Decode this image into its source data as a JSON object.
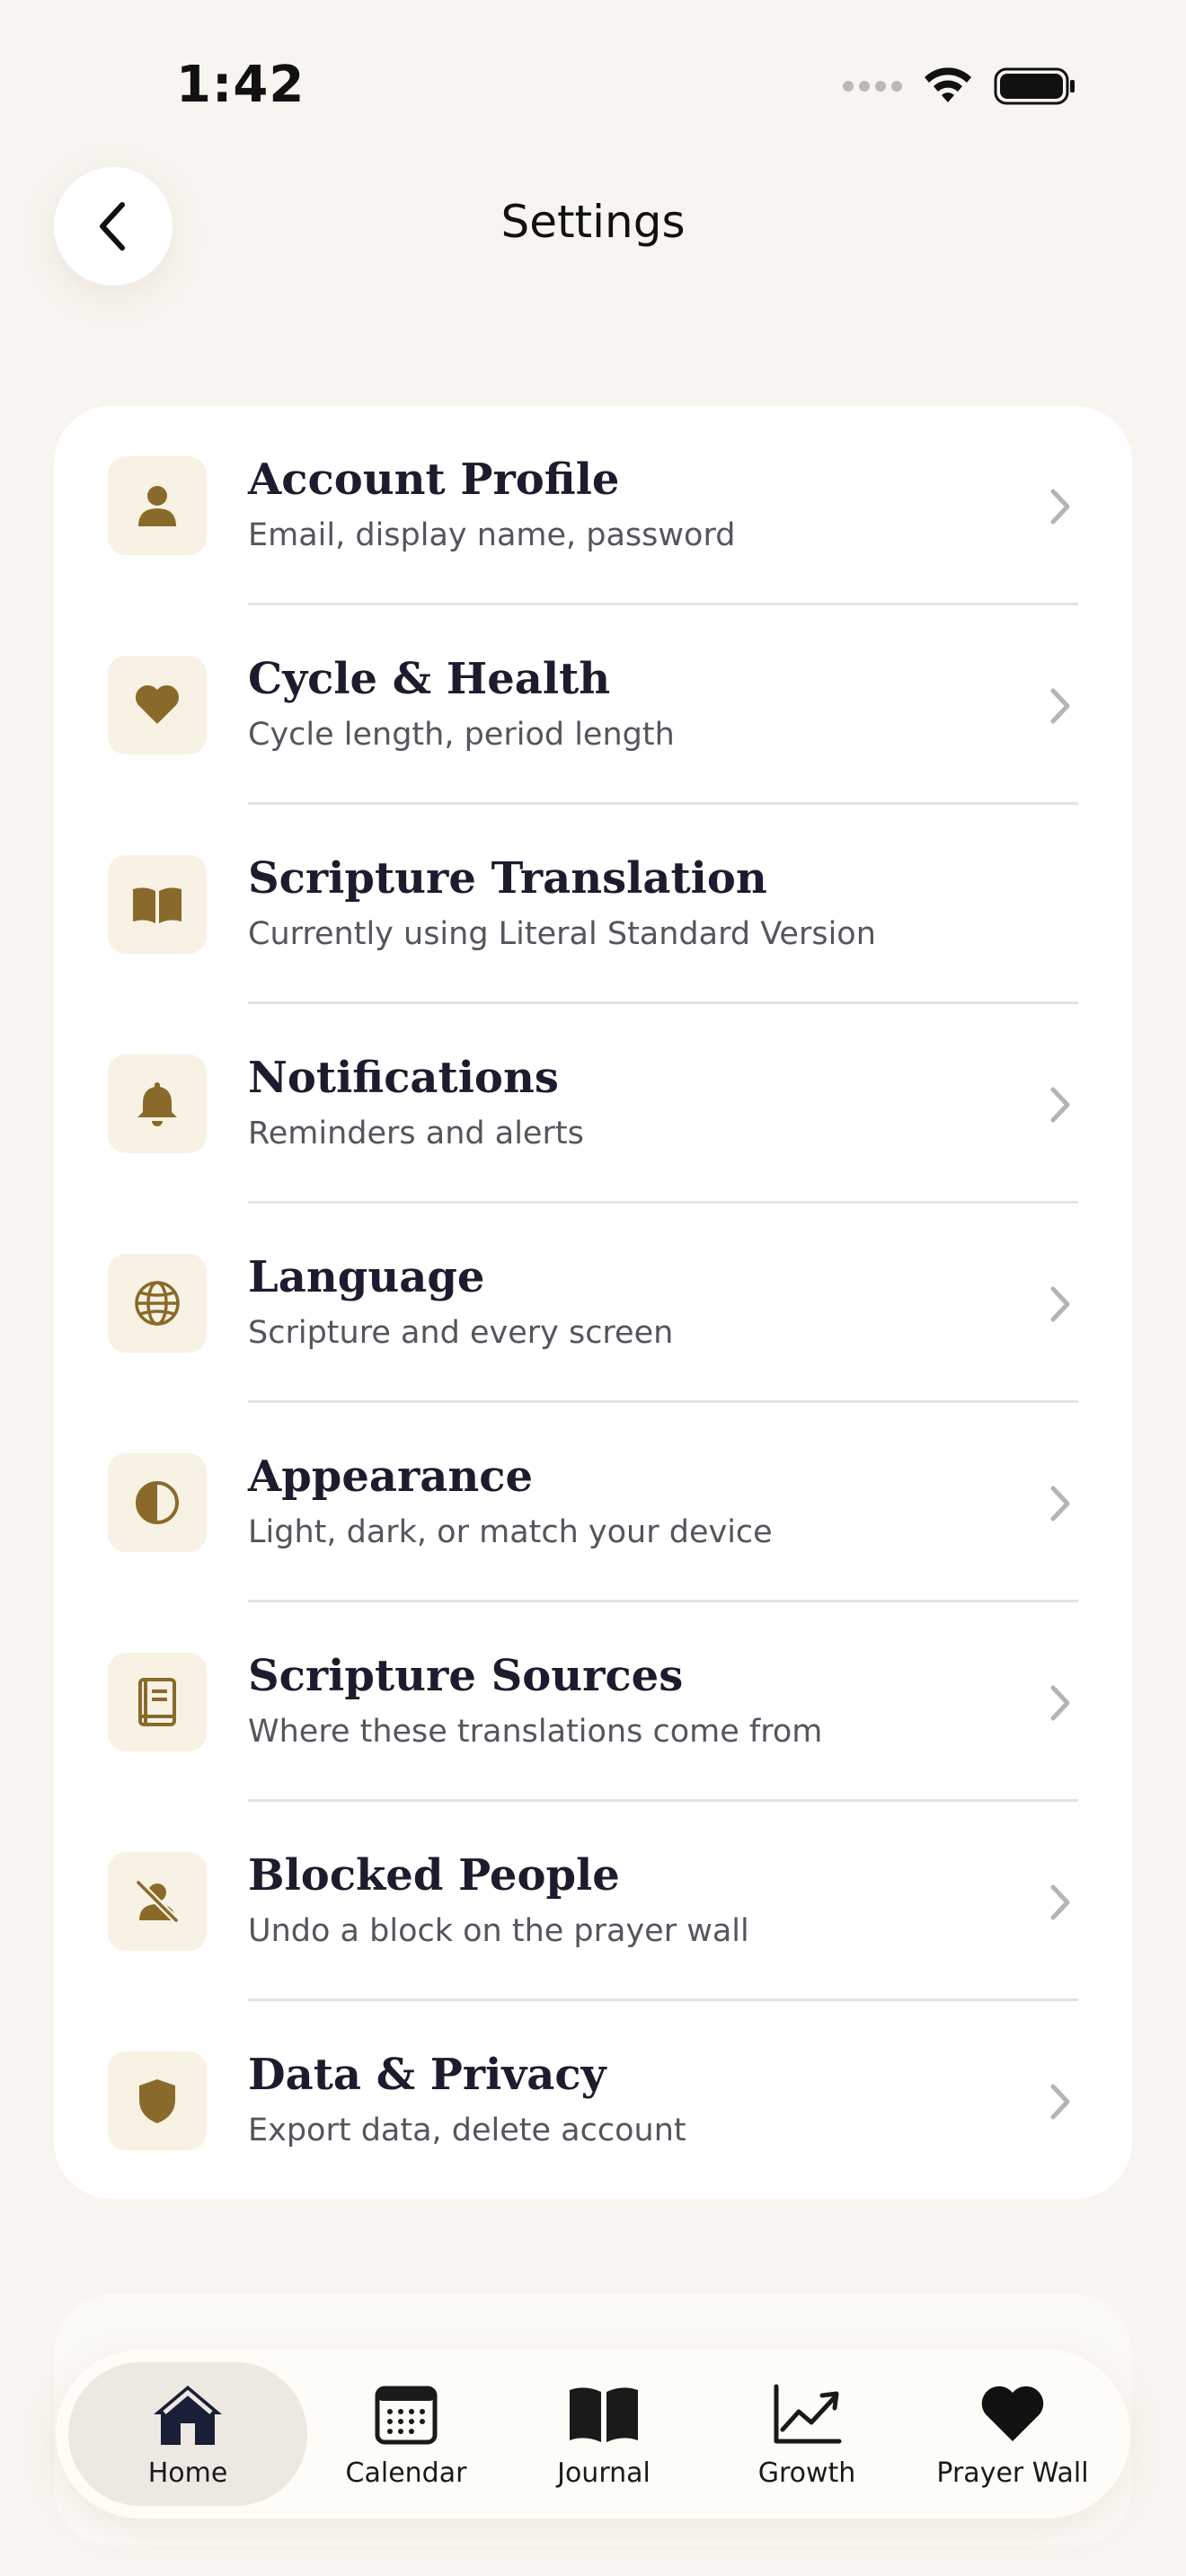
{
  "status_bar": {
    "time": "1:42"
  },
  "header": {
    "title": "Settings"
  },
  "colors": {
    "background": "#f8f5f0",
    "card": "#ffffff",
    "accent": "#8a6a2a",
    "icon_tile": "#f8f2e4",
    "title_text": "#1c1c2e",
    "subtitle_text": "#55555e"
  },
  "settings": {
    "items": [
      {
        "title": "Account Profile",
        "subtitle": "Email, display name, password",
        "icon": "person-icon",
        "chevron": true
      },
      {
        "title": "Cycle & Health",
        "subtitle": "Cycle length, period length",
        "icon": "heart-icon",
        "chevron": true
      },
      {
        "title": "Scripture Translation",
        "subtitle": "Currently using Literal Standard Version",
        "icon": "open-book-icon",
        "chevron": false
      },
      {
        "title": "Notifications",
        "subtitle": "Reminders and alerts",
        "icon": "bell-icon",
        "chevron": true
      },
      {
        "title": "Language",
        "subtitle": "Scripture and every screen",
        "icon": "globe-icon",
        "chevron": true
      },
      {
        "title": "Appearance",
        "subtitle": "Light, dark, or match your device",
        "icon": "half-circle-icon",
        "chevron": true
      },
      {
        "title": "Scripture Sources",
        "subtitle": "Where these translations come from",
        "icon": "book-icon",
        "chevron": true
      },
      {
        "title": "Blocked People",
        "subtitle": "Undo a block on the prayer wall",
        "icon": "person-slash-icon",
        "chevron": true
      },
      {
        "title": "Data & Privacy",
        "subtitle": "Export data, delete account",
        "icon": "shield-icon",
        "chevron": true
      }
    ]
  },
  "tab_bar": {
    "tabs": [
      {
        "label": "Home",
        "icon": "house-icon",
        "active": true
      },
      {
        "label": "Calendar",
        "icon": "calendar-icon",
        "active": false
      },
      {
        "label": "Journal",
        "icon": "book-icon",
        "active": false
      },
      {
        "label": "Growth",
        "icon": "chart-line-icon",
        "active": false
      },
      {
        "label": "Prayer Wall",
        "icon": "heart-icon",
        "active": false
      }
    ]
  }
}
